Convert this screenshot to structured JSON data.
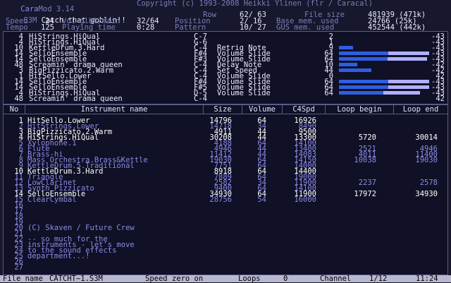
{
  "title_left": "Cara",
  "title_mid": "Mod 3.14",
  "copyright": "Copyright (c) 1993-2008 Heikki Ylinen (flr / Caracal)",
  "header": {
    "fmt": "S3M",
    "song_name": "Catch that goblin!!",
    "row_label": "Row",
    "row_value": "62/ 63",
    "file_size_label": "File size",
    "file_size_value": "481939 (471k)",
    "speed_label": "Speed",
    "speed_value": "24",
    "vol_label": "Vol glbl/main",
    "vol_value": "32/64",
    "position_label": "Position",
    "position_value": "2/ 16",
    "base_mem_label": "Base mem. used",
    "base_mem_value": "24766 (25k)",
    "tempo_label": "Tempo",
    "tempo_value": "125",
    "play_time_label": "Playing time",
    "play_time_value": "0:28",
    "pattern_label": "Pattern",
    "pattern_value": "10/ 27",
    "gus_mem_label": "GUS mem. used",
    "gus_mem_value": "452544 (442k)"
  },
  "channels": [
    {
      "num": "4",
      "inst": "HiStrings.HiQual",
      "note": "C-7",
      "effect": "",
      "vol": "2",
      "bar": 0,
      "pan": "-43"
    },
    {
      "num": "4",
      "inst": "HiStrings.HiQual",
      "note": "G-6",
      "effect": "",
      "vol": "1",
      "bar": 0,
      "pan": "-43"
    },
    {
      "num": "10",
      "inst": "KettleDrum.3.Hard",
      "note": "C-4",
      "effect": "Retrig Note",
      "vol": "9",
      "bar": 0.16,
      "pan": "-43"
    },
    {
      "num": "14",
      "inst": "SelloEnsemble",
      "note": "F#4",
      "effect": "Volume Slide",
      "vol": "64",
      "bar": 1.0,
      "pan": "-43"
    },
    {
      "num": "14",
      "inst": "SelloEnsemble",
      "note": "F#3",
      "effect": "Volume Slide",
      "vol": "64",
      "bar": 0.98,
      "pan": "-43"
    },
    {
      "num": "48",
      "inst": "Screamin' drama queen",
      "note": "C-4",
      "effect": "Delay Note",
      "vol": "10",
      "bar": 0.2,
      "pan": "-42"
    },
    {
      "num": "3",
      "inst": "BigPizzicato.2.Warm",
      "note": "C-4",
      "effect": "Set Speed",
      "vol": "44",
      "bar": 0.36,
      "pan": "-42"
    },
    {
      "num": "1",
      "inst": "HitSello.Lower",
      "note": "C-4",
      "effect": "Volume Slide",
      "vol": "0",
      "bar": 0,
      "pan": "42"
    },
    {
      "num": "14",
      "inst": "SelloEnsemble",
      "note": "F#4",
      "effect": "Volume Slide",
      "vol": "64",
      "bar": 1.0,
      "pan": "-43"
    },
    {
      "num": "14",
      "inst": "SelloEnsemble",
      "note": "F#5",
      "effect": "Volume Slide",
      "vol": "64",
      "bar": 1.0,
      "pan": "-43"
    },
    {
      "num": "4",
      "inst": "HiStrings.HiQual",
      "note": "D-5",
      "effect": "Volume Slide",
      "vol": "64",
      "bar": 0.9,
      "pan": "-43"
    },
    {
      "num": "48",
      "inst": "Screamin' drama queen",
      "note": "C-4",
      "effect": "",
      "vol": "",
      "bar": 0,
      "pan": "42"
    }
  ],
  "columns": {
    "no": "No",
    "name": "Instrument name",
    "size": "Size",
    "volume": "Volume",
    "c4spd": "C4Spd",
    "loop_begin": "Loop begin",
    "loop_end": "Loop end"
  },
  "instruments": [
    {
      "no": "1",
      "name": "HitSello.Lower",
      "size": "14796",
      "vol": "64",
      "c4": "16926",
      "lb": "",
      "le": "",
      "active": true
    },
    {
      "no": "2",
      "name": "HitStrings.Lower",
      "size": "14718",
      "vol": "34",
      "c4": "8490",
      "lb": "",
      "le": "",
      "active": false
    },
    {
      "no": "3",
      "name": "BigPizzicato.2.Warm",
      "size": "4911",
      "vol": "44",
      "c4": "9500",
      "lb": "",
      "le": "",
      "active": true
    },
    {
      "no": "4",
      "name": "HiStrings.HiQual",
      "size": "30208",
      "vol": "44",
      "c4": "13300",
      "lb": "5720",
      "le": "30014",
      "active": true
    },
    {
      "no": "5",
      "name": "Xylophone.1",
      "size": "4188",
      "vol": "64",
      "c4": "14100",
      "lb": "",
      "le": "",
      "active": false
    },
    {
      "no": "6",
      "name": "Flute",
      "size": "4946",
      "vol": "44",
      "c4": "13400",
      "lb": "2521",
      "le": "4946",
      "active": false
    },
    {
      "no": "7",
      "name": "Brass-hi",
      "size": "11412",
      "vol": "44",
      "c4": "14083",
      "lb": "4011",
      "le": "11400",
      "active": false
    },
    {
      "no": "8",
      "name": "Mass Orchestra.Brass&Kettle",
      "size": "19030",
      "vol": "64",
      "c4": "14150",
      "lb": "10038",
      "le": "19030",
      "active": false
    },
    {
      "no": "9",
      "name": "KettleDrum.5.Traditional",
      "size": "7751",
      "vol": "64",
      "c4": "14000",
      "lb": "",
      "le": "",
      "active": false
    },
    {
      "no": "10",
      "name": "KettleDrum.3.Hard",
      "size": "8918",
      "vol": "64",
      "c4": "14400",
      "lb": "",
      "le": "",
      "active": true
    },
    {
      "no": "11",
      "name": "Triangle",
      "size": "7889",
      "vol": "64",
      "c4": "19000",
      "lb": "",
      "le": "",
      "active": false
    },
    {
      "no": "12",
      "name": "LowClarinet",
      "size": "2582",
      "vol": "34",
      "c4": "11900",
      "lb": "2237",
      "le": "2578",
      "active": false
    },
    {
      "no": "13",
      "name": "Synth Pizzicato",
      "size": "9400",
      "vol": "64",
      "c4": "14100",
      "lb": "",
      "le": "",
      "active": false
    },
    {
      "no": "14",
      "name": "SelloEnsemble",
      "size": "34930",
      "vol": "64",
      "c4": "11900",
      "lb": "17972",
      "le": "34930",
      "active": true
    },
    {
      "no": "15",
      "name": "ClearCymbal",
      "size": "28756",
      "vol": "54",
      "c4": "16000",
      "lb": "",
      "le": "",
      "active": false
    },
    {
      "no": "16",
      "name": "",
      "size": "",
      "vol": "",
      "c4": "",
      "lb": "",
      "le": "",
      "active": false
    },
    {
      "no": "17",
      "name": "",
      "size": "",
      "vol": "",
      "c4": "",
      "lb": "",
      "le": "",
      "active": false
    },
    {
      "no": "18",
      "name": "",
      "size": "",
      "vol": "",
      "c4": "",
      "lb": "",
      "le": "",
      "active": false
    },
    {
      "no": "19",
      "name": "",
      "size": "",
      "vol": "",
      "c4": "",
      "lb": "",
      "le": "",
      "active": false
    },
    {
      "no": "20",
      "name": "(C) Skaven / Future Crew",
      "size": "",
      "vol": "",
      "c4": "",
      "lb": "",
      "le": "",
      "active": false
    },
    {
      "no": "21",
      "name": "",
      "size": "",
      "vol": "",
      "c4": "",
      "lb": "",
      "le": "",
      "active": false
    },
    {
      "no": "22",
      "name": "-- so much for the",
      "size": "",
      "vol": "",
      "c4": "",
      "lb": "",
      "le": "",
      "active": false
    },
    {
      "no": "23",
      "name": "instruments - let's move",
      "size": "",
      "vol": "",
      "c4": "",
      "lb": "",
      "le": "",
      "active": false
    },
    {
      "no": "24",
      "name": "to the sound effects",
      "size": "",
      "vol": "",
      "c4": "",
      "lb": "",
      "le": "",
      "active": false
    },
    {
      "no": "25",
      "name": "department...!",
      "size": "",
      "vol": "",
      "c4": "",
      "lb": "",
      "le": "",
      "active": false
    },
    {
      "no": "26",
      "name": "",
      "size": "",
      "vol": "",
      "c4": "",
      "lb": "",
      "le": "",
      "active": false
    },
    {
      "no": "27",
      "name": "",
      "size": "",
      "vol": "",
      "c4": "",
      "lb": "",
      "le": "",
      "active": false
    }
  ],
  "status": {
    "file_label": "File name",
    "file_value": "CATCHT~1.S3M",
    "speed_zero": "Speed zero on",
    "loops_label": "Loops",
    "loops_value": "0",
    "channel_label": "Channel",
    "channel_value": "1/12",
    "clock": "11:24"
  },
  "colors": {
    "bg": "#17172e",
    "bar_fill": "#2e5fe0",
    "bar_highlight": "#b0b0ff",
    "status_bg": "#b8b8d0"
  }
}
